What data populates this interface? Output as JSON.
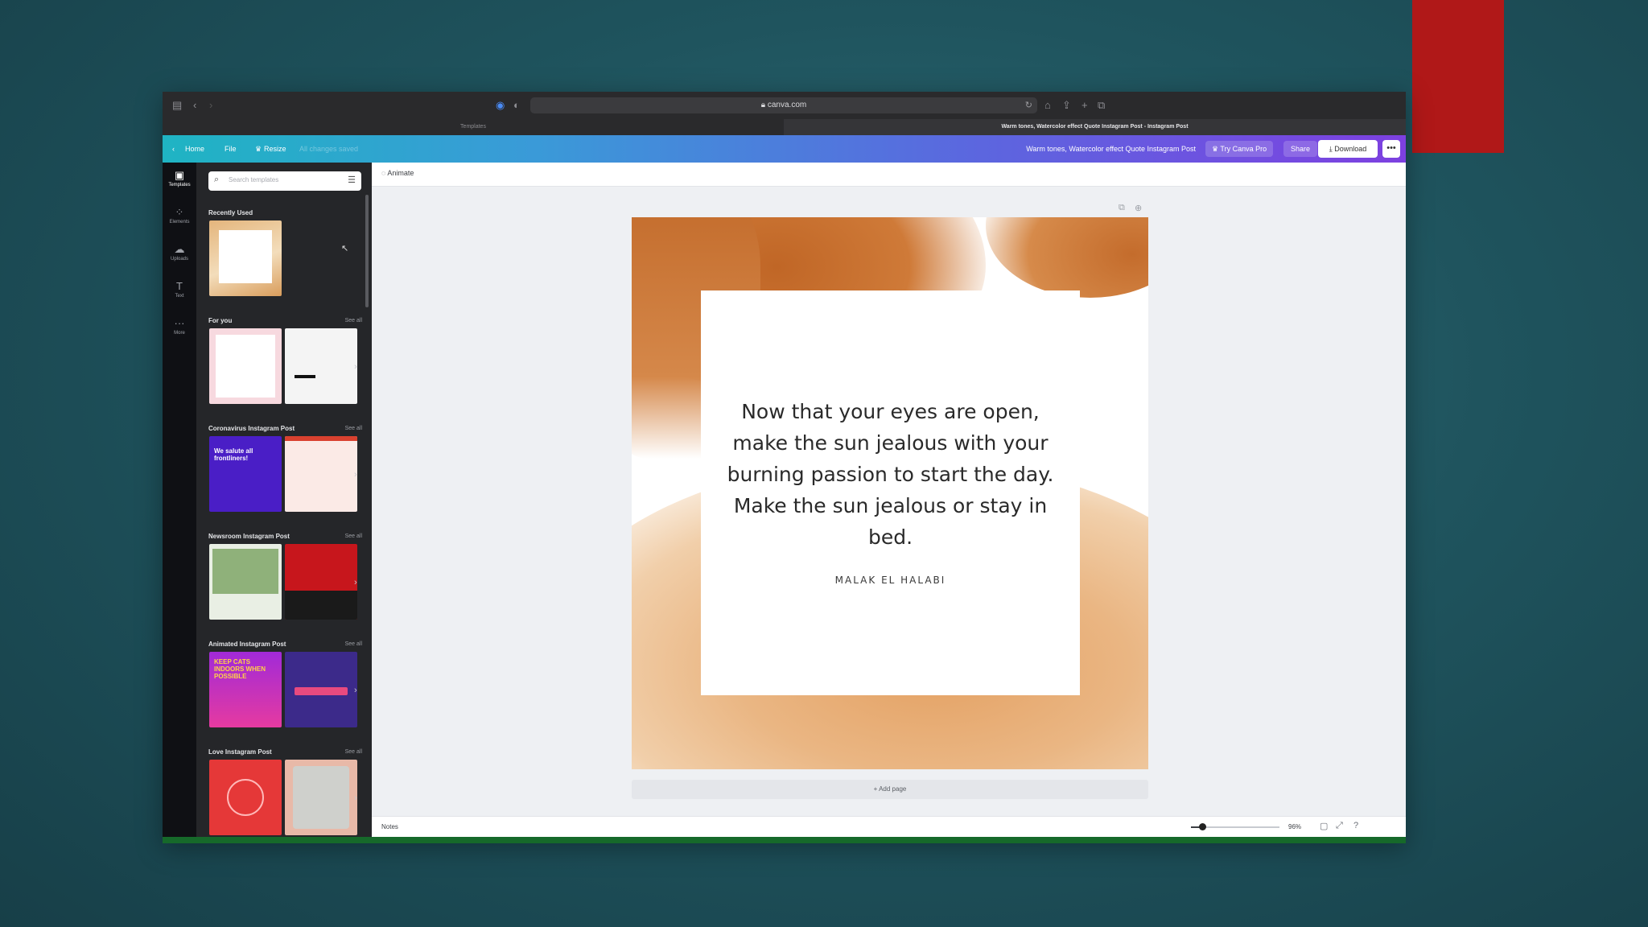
{
  "browser": {
    "url": "canva.com",
    "tabs": [
      {
        "label": "Templates"
      },
      {
        "label": "Warm tones, Watercolor effect Quote Instagram Post - Instagram Post"
      }
    ]
  },
  "header": {
    "back_label": "Home",
    "file_label": "File",
    "resize_label": "Resize",
    "saved_label": "All changes saved",
    "design_title": "Warm tones, Watercolor effect Quote Instagram Post",
    "try_pro_label": "Try Canva Pro",
    "share_label": "Share",
    "download_label": "Download",
    "more_label": "•••",
    "gradient_colors": [
      "#1fb4c3",
      "#7d40e0"
    ]
  },
  "rail": {
    "items": [
      {
        "label": "Templates",
        "icon": "templates-icon"
      },
      {
        "label": "Elements",
        "icon": "elements-icon"
      },
      {
        "label": "Uploads",
        "icon": "uploads-icon"
      },
      {
        "label": "Text",
        "icon": "text-icon"
      },
      {
        "label": "More",
        "icon": "more-icon"
      }
    ]
  },
  "panel": {
    "search_placeholder": "Search templates",
    "see_all": "See all",
    "sections": [
      {
        "title": "Recently Used"
      },
      {
        "title": "For you"
      },
      {
        "title": "Coronavirus Instagram Post"
      },
      {
        "title": "Newsroom Instagram Post"
      },
      {
        "title": "Animated Instagram Post"
      },
      {
        "title": "Love Instagram Post"
      }
    ],
    "thumb_texts": {
      "salute": "We salute all frontliners!",
      "cats": "KEEP CATS INDOORS WHEN POSSIBLE"
    }
  },
  "editor": {
    "animate_label": "Animate",
    "quote": "Now that your eyes are open, make the sun jealous with your burning passion to start the day. Make the sun jealous or stay in bed.",
    "author": "MALAK EL HALABI",
    "add_page_label": "+ Add page",
    "notes_label": "Notes",
    "zoom": {
      "value_label": "96%",
      "fraction": 0.13
    }
  },
  "colors": {
    "accent_watercolor": "#c26a2a",
    "canvas_bg": "#ffffff",
    "sidebar_bg": "#252629"
  }
}
